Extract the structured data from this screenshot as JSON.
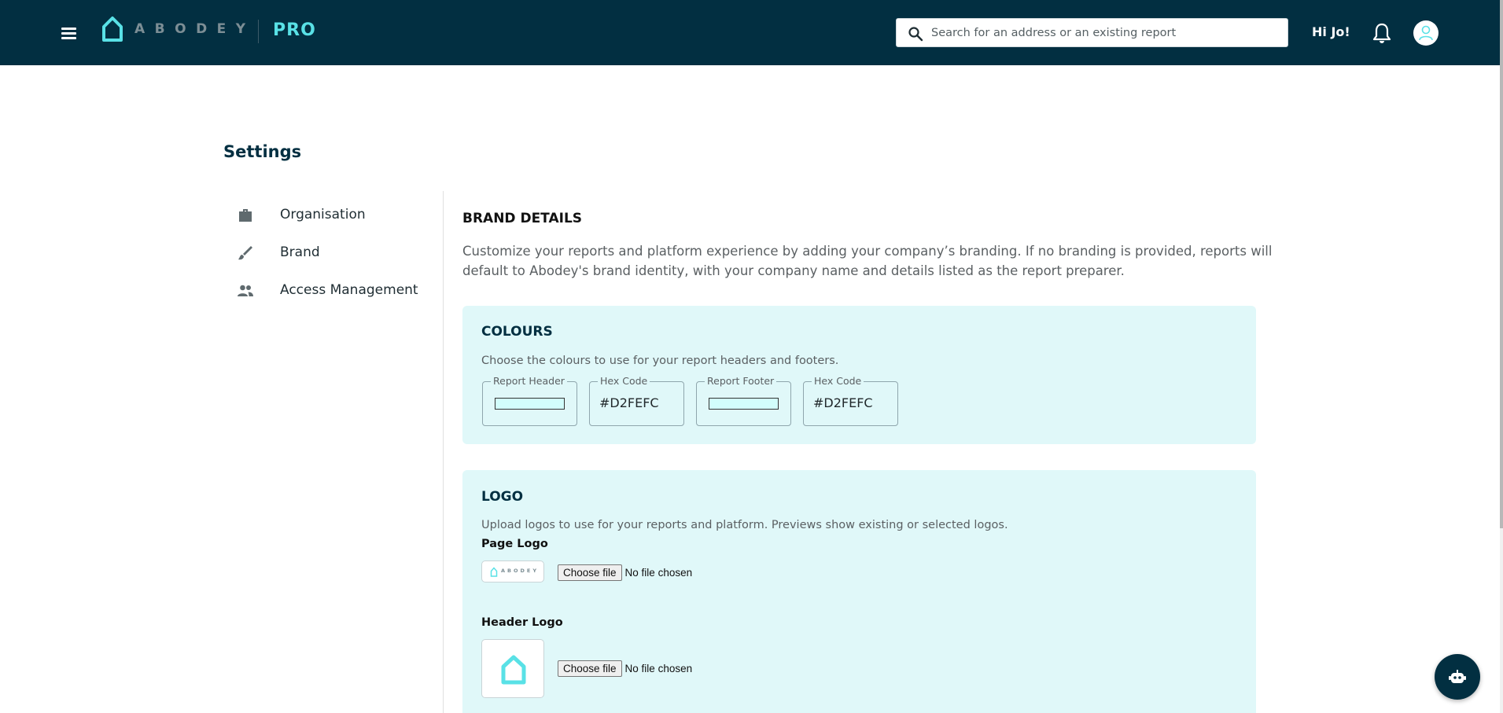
{
  "header": {
    "logo_word": "ABODEY",
    "pro_label": "PRO",
    "search_placeholder": "Search for an address or an existing report",
    "greeting": "Hi Jo!",
    "bg_color": "#022F41",
    "accent_color": "#59E1E6"
  },
  "page": {
    "title": "Settings"
  },
  "sidebar": {
    "items": [
      {
        "label": "Organisation",
        "icon": "briefcase-icon"
      },
      {
        "label": "Brand",
        "icon": "brush-icon"
      },
      {
        "label": "Access Management",
        "icon": "people-icon"
      }
    ]
  },
  "brand": {
    "title": "BRAND DETAILS",
    "intro": "Customize your reports and platform experience by adding your company’s branding. If no branding is provided, reports will default to Abodey's brand identity, with your company name and details listed as the report preparer."
  },
  "colours": {
    "title": "COLOURS",
    "description": "Choose the colours to use for your report headers and footers.",
    "header_label": "Report Header",
    "header_hex_label": "Hex Code",
    "header_hex": "#D2FEFC",
    "footer_label": "Report Footer",
    "footer_hex_label": "Hex Code",
    "footer_hex": "#D2FEFC"
  },
  "logo": {
    "title": "LOGO",
    "description": "Upload logos to use for your reports and platform. Previews show existing or selected logos.",
    "page_logo_label": "Page Logo",
    "header_logo_label": "Header Logo",
    "choose_file": "Choose file",
    "no_file": "No file chosen",
    "preview_word": "ABODEY"
  }
}
